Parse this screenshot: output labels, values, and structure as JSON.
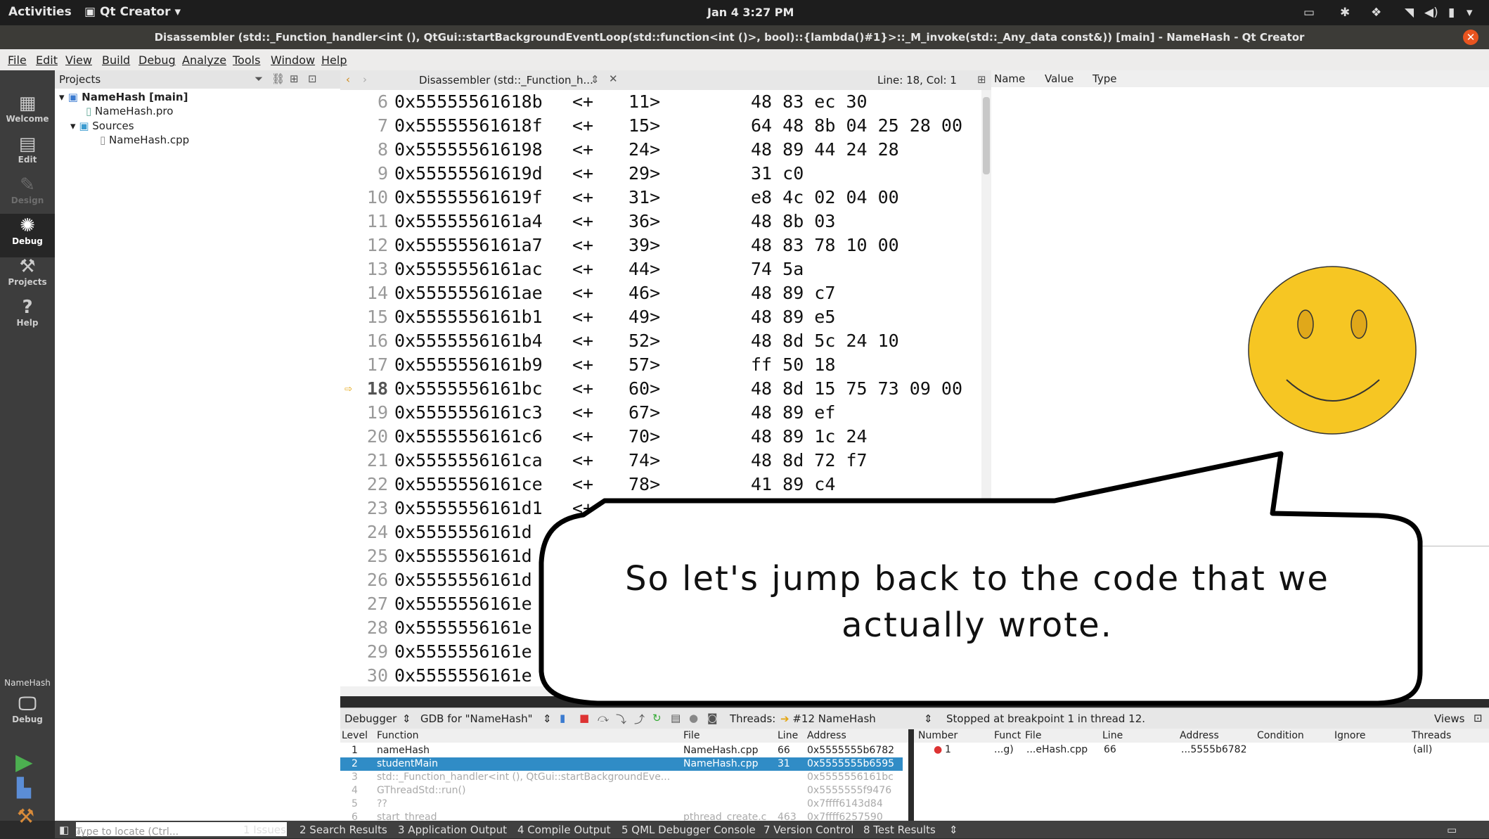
{
  "topbar": {
    "activities": "Activities",
    "app_menu": "Qt Creator",
    "clock": "Jan 4   3:27 PM"
  },
  "window": {
    "title": "Disassembler (std::_Function_handler<int (), QtGui::startBackgroundEventLoop(std::function<int ()>, bool)::{lambda()#1}>::_M_invoke(std::_Any_data const&)) [main] - NameHash - Qt Creator"
  },
  "menu": [
    "File",
    "Edit",
    "View",
    "Build",
    "Debug",
    "Analyze",
    "Tools",
    "Window",
    "Help"
  ],
  "modes": [
    {
      "label": "Welcome",
      "icon": "grid-icon"
    },
    {
      "label": "Edit",
      "icon": "document-icon"
    },
    {
      "label": "Design",
      "icon": "pencil-icon"
    },
    {
      "label": "Debug",
      "icon": "bug-icon"
    },
    {
      "label": "Projects",
      "icon": "wrench-icon"
    },
    {
      "label": "Help",
      "icon": "help-icon"
    }
  ],
  "kit": {
    "project": "NameHash",
    "config": "Debug"
  },
  "projects": {
    "header": "Projects",
    "root": "NameHash [main]",
    "pro": "NameHash.pro",
    "sources": "Sources",
    "cpp": "NameHash.cpp"
  },
  "editor": {
    "doc_title": "Disassembler (std::_Function_h...",
    "position": "Line: 18, Col: 1",
    "current_line": 18,
    "rows": [
      {
        "n": "6",
        "addr": "0x55555561618b",
        "o1": "<+",
        "o2": "11>",
        "bytes": "48 83 ec 30"
      },
      {
        "n": "7",
        "addr": "0x55555561618f",
        "o1": "<+",
        "o2": "15>",
        "bytes": "64 48 8b 04 25 28 00"
      },
      {
        "n": "8",
        "addr": "0x555555616198",
        "o1": "<+",
        "o2": "24>",
        "bytes": "48 89 44 24 28"
      },
      {
        "n": "9",
        "addr": "0x55555561619d",
        "o1": "<+",
        "o2": "29>",
        "bytes": "31 c0"
      },
      {
        "n": "10",
        "addr": "0x55555561619f",
        "o1": "<+",
        "o2": "31>",
        "bytes": "e8 4c 02 04 00"
      },
      {
        "n": "11",
        "addr": "0x5555556161a4",
        "o1": "<+",
        "o2": "36>",
        "bytes": "48 8b 03"
      },
      {
        "n": "12",
        "addr": "0x5555556161a7",
        "o1": "<+",
        "o2": "39>",
        "bytes": "48 83 78 10 00"
      },
      {
        "n": "13",
        "addr": "0x5555556161ac",
        "o1": "<+",
        "o2": "44>",
        "bytes": "74 5a"
      },
      {
        "n": "14",
        "addr": "0x5555556161ae",
        "o1": "<+",
        "o2": "46>",
        "bytes": "48 89 c7"
      },
      {
        "n": "15",
        "addr": "0x5555556161b1",
        "o1": "<+",
        "o2": "49>",
        "bytes": "48 89 e5"
      },
      {
        "n": "16",
        "addr": "0x5555556161b4",
        "o1": "<+",
        "o2": "52>",
        "bytes": "48 8d 5c 24 10"
      },
      {
        "n": "17",
        "addr": "0x5555556161b9",
        "o1": "<+",
        "o2": "57>",
        "bytes": "ff 50 18"
      },
      {
        "n": "18",
        "addr": "0x5555556161bc",
        "o1": "<+",
        "o2": "60>",
        "bytes": "48 8d 15 75 73 09 00"
      },
      {
        "n": "19",
        "addr": "0x5555556161c3",
        "o1": "<+",
        "o2": "67>",
        "bytes": "48 89 ef"
      },
      {
        "n": "20",
        "addr": "0x5555556161c6",
        "o1": "<+",
        "o2": "70>",
        "bytes": "48 89 1c 24"
      },
      {
        "n": "21",
        "addr": "0x5555556161ca",
        "o1": "<+",
        "o2": "74>",
        "bytes": "48 8d 72 f7"
      },
      {
        "n": "22",
        "addr": "0x5555556161ce",
        "o1": "<+",
        "o2": "78>",
        "bytes": "41 89 c4"
      },
      {
        "n": "23",
        "addr": "0x5555556161d1",
        "o1": "<+",
        "o2": "",
        "bytes": ""
      },
      {
        "n": "24",
        "addr": "0x5555556161d",
        "o1": "",
        "o2": "",
        "bytes": ""
      },
      {
        "n": "25",
        "addr": "0x5555556161d",
        "o1": "",
        "o2": "",
        "bytes": ""
      },
      {
        "n": "26",
        "addr": "0x5555556161d",
        "o1": "",
        "o2": "",
        "bytes": ""
      },
      {
        "n": "27",
        "addr": "0x5555556161e",
        "o1": "",
        "o2": "",
        "bytes": ""
      },
      {
        "n": "28",
        "addr": "0x5555556161e",
        "o1": "",
        "o2": "",
        "bytes": ""
      },
      {
        "n": "29",
        "addr": "0x5555556161e",
        "o1": "",
        "o2": "",
        "bytes": ""
      },
      {
        "n": "30",
        "addr": "0x5555556161e",
        "o1": "",
        "o2": "",
        "bytes": ""
      }
    ]
  },
  "watch": {
    "cols": [
      "Name",
      "Value",
      "Type"
    ]
  },
  "debugger": {
    "engine": "Debugger",
    "gdb": "GDB for \"NameHash\"",
    "threads_label": "Threads:",
    "thread": "#12 NameHash",
    "status": "Stopped at breakpoint 1 in thread 12.",
    "views": "Views",
    "stack_cols": [
      "Level",
      "Function",
      "File",
      "Line",
      "Address"
    ],
    "stack": [
      {
        "level": "1",
        "func": "nameHash",
        "file": "NameHash.cpp",
        "line": "66",
        "addr": "0x5555555b6782"
      },
      {
        "level": "2",
        "func": "studentMain",
        "file": "NameHash.cpp",
        "line": "31",
        "addr": "0x5555555b6595"
      },
      {
        "level": "3",
        "func": "std::_Function_handler<int (), QtGui::startBackgroundEve...",
        "file": "",
        "line": "",
        "addr": "0x5555556161bc"
      },
      {
        "level": "4",
        "func": "GThreadStd::run()",
        "file": "",
        "line": "",
        "addr": "0x5555555f9476"
      },
      {
        "level": "5",
        "func": "??",
        "file": "",
        "line": "",
        "addr": "0x7ffff6143d84"
      },
      {
        "level": "6",
        "func": "start_thread",
        "file": "pthread_create.c",
        "line": "463",
        "addr": "0x7ffff6257590"
      }
    ],
    "bp_cols": [
      "Number",
      "Funct",
      "File",
      "Line",
      "Address",
      "Condition",
      "Ignore",
      "Threads"
    ],
    "bp": {
      "number": "1",
      "func": "...g)",
      "file": "...eHash.cpp",
      "line": "66",
      "addr": "...5555b6782",
      "threads": "(all)"
    }
  },
  "outputbar": {
    "locate_placeholder": "Type to locate (Ctrl...",
    "tabs": [
      "1  Issues",
      "2  Search Results",
      "3  Application Output",
      "4  Compile Output",
      "5  QML Debugger Console",
      "7  Version Control",
      "8  Test Results"
    ]
  },
  "bubble": {
    "text": "So let's jump back to the code that we actually wrote."
  },
  "colors": {
    "accent": "#308cc6",
    "close": "#e9541f",
    "smiley": "#f6c623"
  }
}
